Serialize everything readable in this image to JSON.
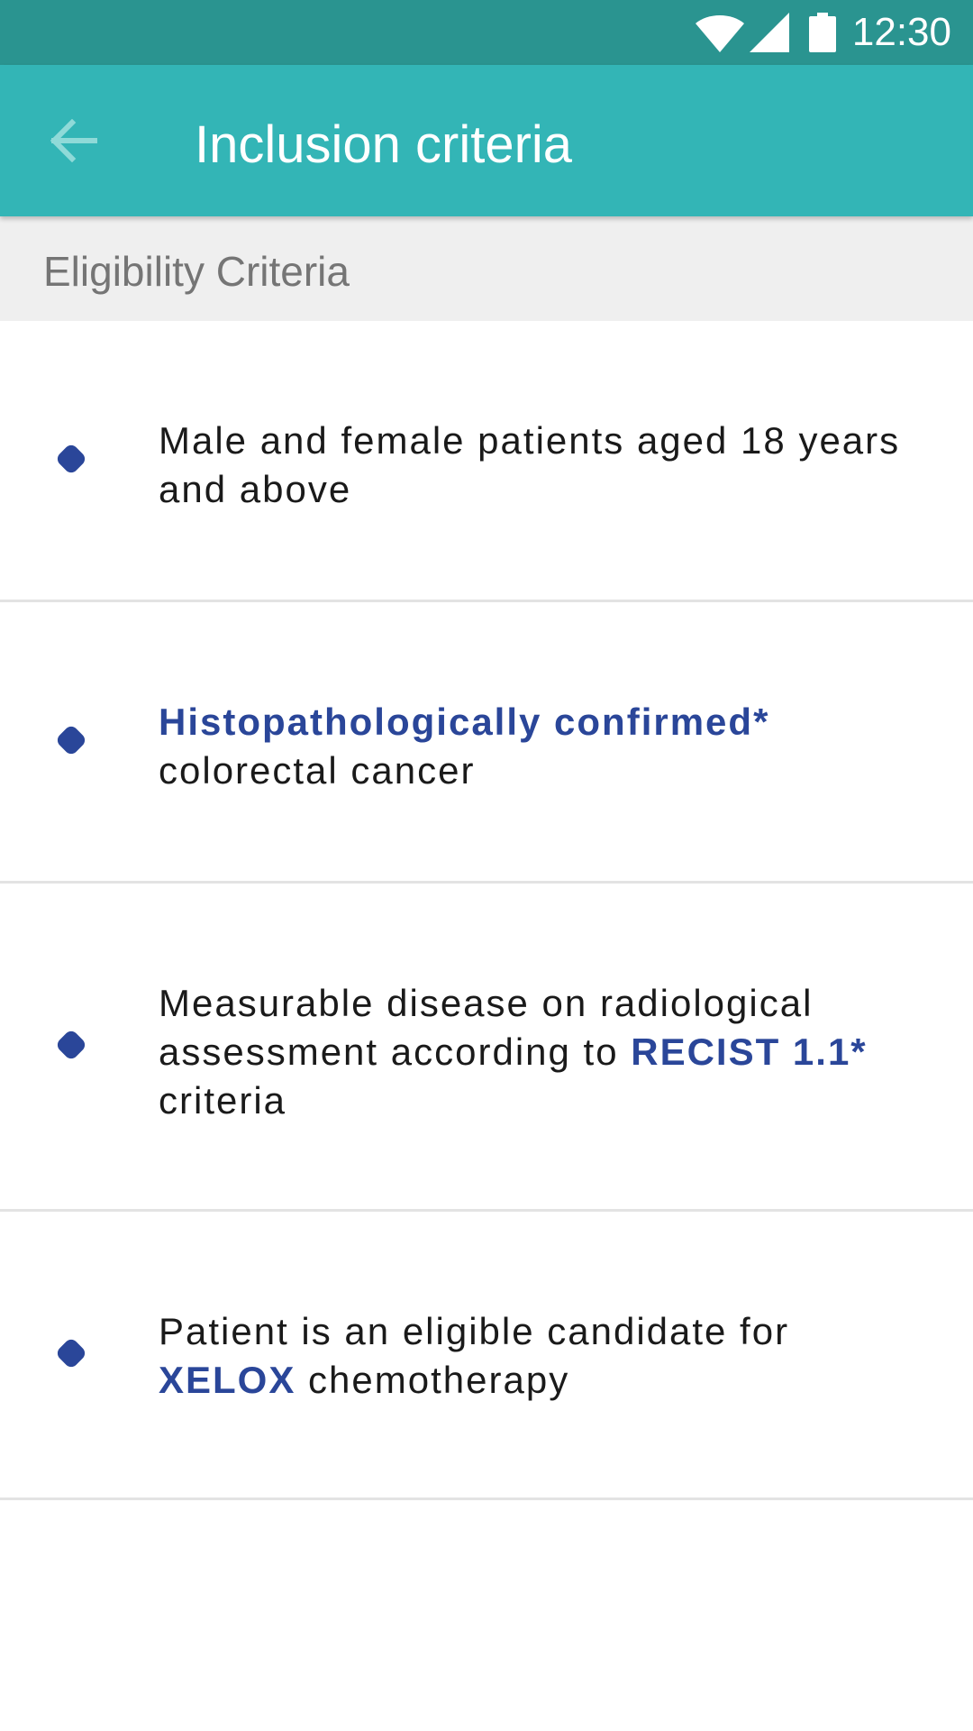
{
  "status_bar": {
    "time": "12:30",
    "icons": [
      "wifi-icon",
      "signal-icon",
      "battery-icon"
    ]
  },
  "app_bar": {
    "back_icon": "arrow-left-icon",
    "title": "Inclusion criteria"
  },
  "section": {
    "title": "Eligibility Criteria"
  },
  "criteria": [
    {
      "parts": [
        {
          "text": "Male and female patients aged 18 years and above",
          "highlight": false
        }
      ]
    },
    {
      "parts": [
        {
          "text": "Histopathologically confirmed*",
          "highlight": true
        },
        {
          "text": " colorectal cancer",
          "highlight": false
        }
      ]
    },
    {
      "parts": [
        {
          "text": "Measurable disease on radiological assessment according to ",
          "highlight": false
        },
        {
          "text": "RECIST 1.1*",
          "highlight": true
        },
        {
          "text": " criteria",
          "highlight": false
        }
      ]
    },
    {
      "parts": [
        {
          "text": "Patient is an eligible candidate for ",
          "highlight": false
        },
        {
          "text": "XELOX",
          "highlight": true
        },
        {
          "text": " chemotherapy",
          "highlight": false
        }
      ]
    }
  ],
  "colors": {
    "status_bar": "#2a9490",
    "app_bar": "#33b5b6",
    "accent": "#2a4699",
    "section_header_bg": "#efefef",
    "divider": "#e3e3e3"
  }
}
